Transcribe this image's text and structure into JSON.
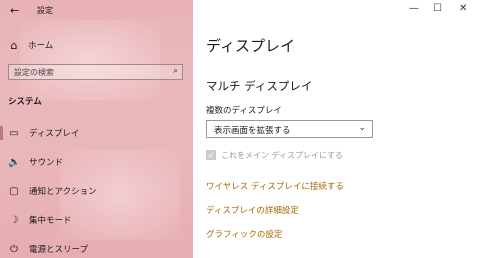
{
  "window": {
    "title": "設定",
    "back_icon": "←",
    "minimize_icon": "—",
    "maximize_icon": "☐",
    "close_icon": "✕"
  },
  "sidebar": {
    "home": {
      "icon": "⌂",
      "label": "ホーム"
    },
    "search": {
      "placeholder": "設定の検索",
      "icon": "⌕"
    },
    "section_title": "システム",
    "items": [
      {
        "icon": "▭",
        "label": "ディスプレイ"
      },
      {
        "icon": "🔈",
        "label": "サウンド"
      },
      {
        "icon": "▢",
        "label": "通知とアクション"
      },
      {
        "icon": "☽",
        "label": "集中モード"
      },
      {
        "icon": "⏻",
        "label": "電源とスリープ"
      }
    ]
  },
  "main": {
    "title": "ディスプレイ",
    "section": "マルチ ディスプレイ",
    "multi_display_label": "複数のディスプレイ",
    "dropdown": {
      "value": "表示画面を拡張する",
      "icon": "⌄"
    },
    "checkbox": {
      "icon": "✓",
      "label": "これをメイン ディスプレイにする"
    },
    "links": [
      "ワイヤレス ディスプレイに接続する",
      "ディスプレイの詳細設定",
      "グラフィックの設定"
    ]
  },
  "colors": {
    "sidebar_bg": "#e9b5b8",
    "accent_link": "#a66a00",
    "active_indicator": "#b77a80"
  }
}
